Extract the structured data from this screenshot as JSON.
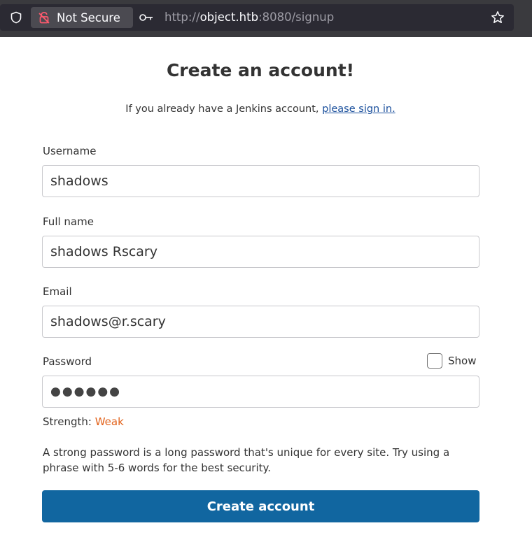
{
  "browser": {
    "security_label": "Not Secure",
    "url_scheme": "http://",
    "url_host": "object.htb",
    "url_rest": ":8080/signup",
    "icons": [
      "shield-icon",
      "broken-lock-icon",
      "key-icon",
      "bookmark-star-icon"
    ]
  },
  "form": {
    "title": "Create an account!",
    "signin_prefix": "If you already have a Jenkins account, ",
    "signin_link": "please sign in.",
    "username_label": "Username",
    "username_value": "shadows",
    "fullname_label": "Full name",
    "fullname_value": "shadows Rscary",
    "email_label": "Email",
    "email_value": "shadows@r.scary",
    "password_label": "Password",
    "password_value": "●●●●●●",
    "show_label": "Show",
    "strength_label": "Strength: ",
    "strength_value": "Weak",
    "hint": "A strong password is a long password that's unique for every site. Try using a phrase with 5-6 words for the best security.",
    "submit_label": "Create account"
  },
  "colors": {
    "link": "#1a4f9c",
    "weak": "#e2621b",
    "button": "#1166a0"
  }
}
